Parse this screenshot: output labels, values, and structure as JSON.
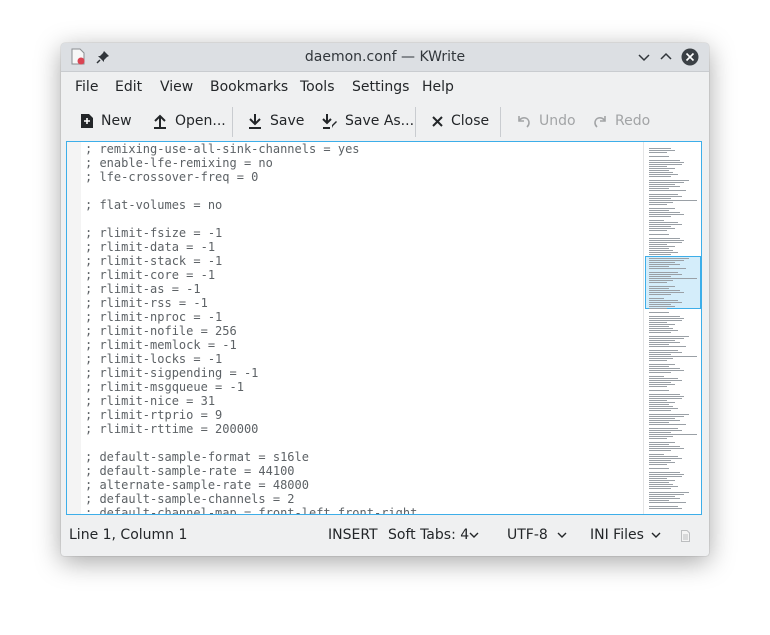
{
  "window": {
    "title": "daemon.conf — KWrite"
  },
  "menubar": {
    "items": [
      "File",
      "Edit",
      "View",
      "Bookmarks",
      "Tools",
      "Settings",
      "Help"
    ]
  },
  "toolbar": {
    "new_label": "New",
    "open_label": "Open...",
    "save_label": "Save",
    "save_as_label": "Save As...",
    "close_label": "Close",
    "undo_label": "Undo",
    "redo_label": "Redo"
  },
  "editor": {
    "lines": [
      "; remixing-use-all-sink-channels = yes",
      "; enable-lfe-remixing = no",
      "; lfe-crossover-freq = 0",
      "",
      "; flat-volumes = no",
      "",
      "; rlimit-fsize = -1",
      "; rlimit-data = -1",
      "; rlimit-stack = -1",
      "; rlimit-core = -1",
      "; rlimit-as = -1",
      "; rlimit-rss = -1",
      "; rlimit-nproc = -1",
      "; rlimit-nofile = 256",
      "; rlimit-memlock = -1",
      "; rlimit-locks = -1",
      "; rlimit-sigpending = -1",
      "; rlimit-msgqueue = -1",
      "; rlimit-nice = 31",
      "; rlimit-rtprio = 9",
      "; rlimit-rttime = 200000",
      "",
      "; default-sample-format = s16le",
      "; default-sample-rate = 44100",
      "; alternate-sample-rate = 48000",
      "; default-sample-channels = 2",
      "; default-channel-map = front-left,front-right"
    ]
  },
  "statusbar": {
    "cursor_position": "Line 1, Column 1",
    "input_mode": "INSERT",
    "indentation": "Soft Tabs: 4",
    "encoding": "UTF-8",
    "syntax_mode": "INI Files"
  },
  "colors": {
    "accent": "#3daee9",
    "window_bg": "#eff0f1",
    "titlebar_bg": "#dcdfe3",
    "close_button": "#3b4045"
  }
}
